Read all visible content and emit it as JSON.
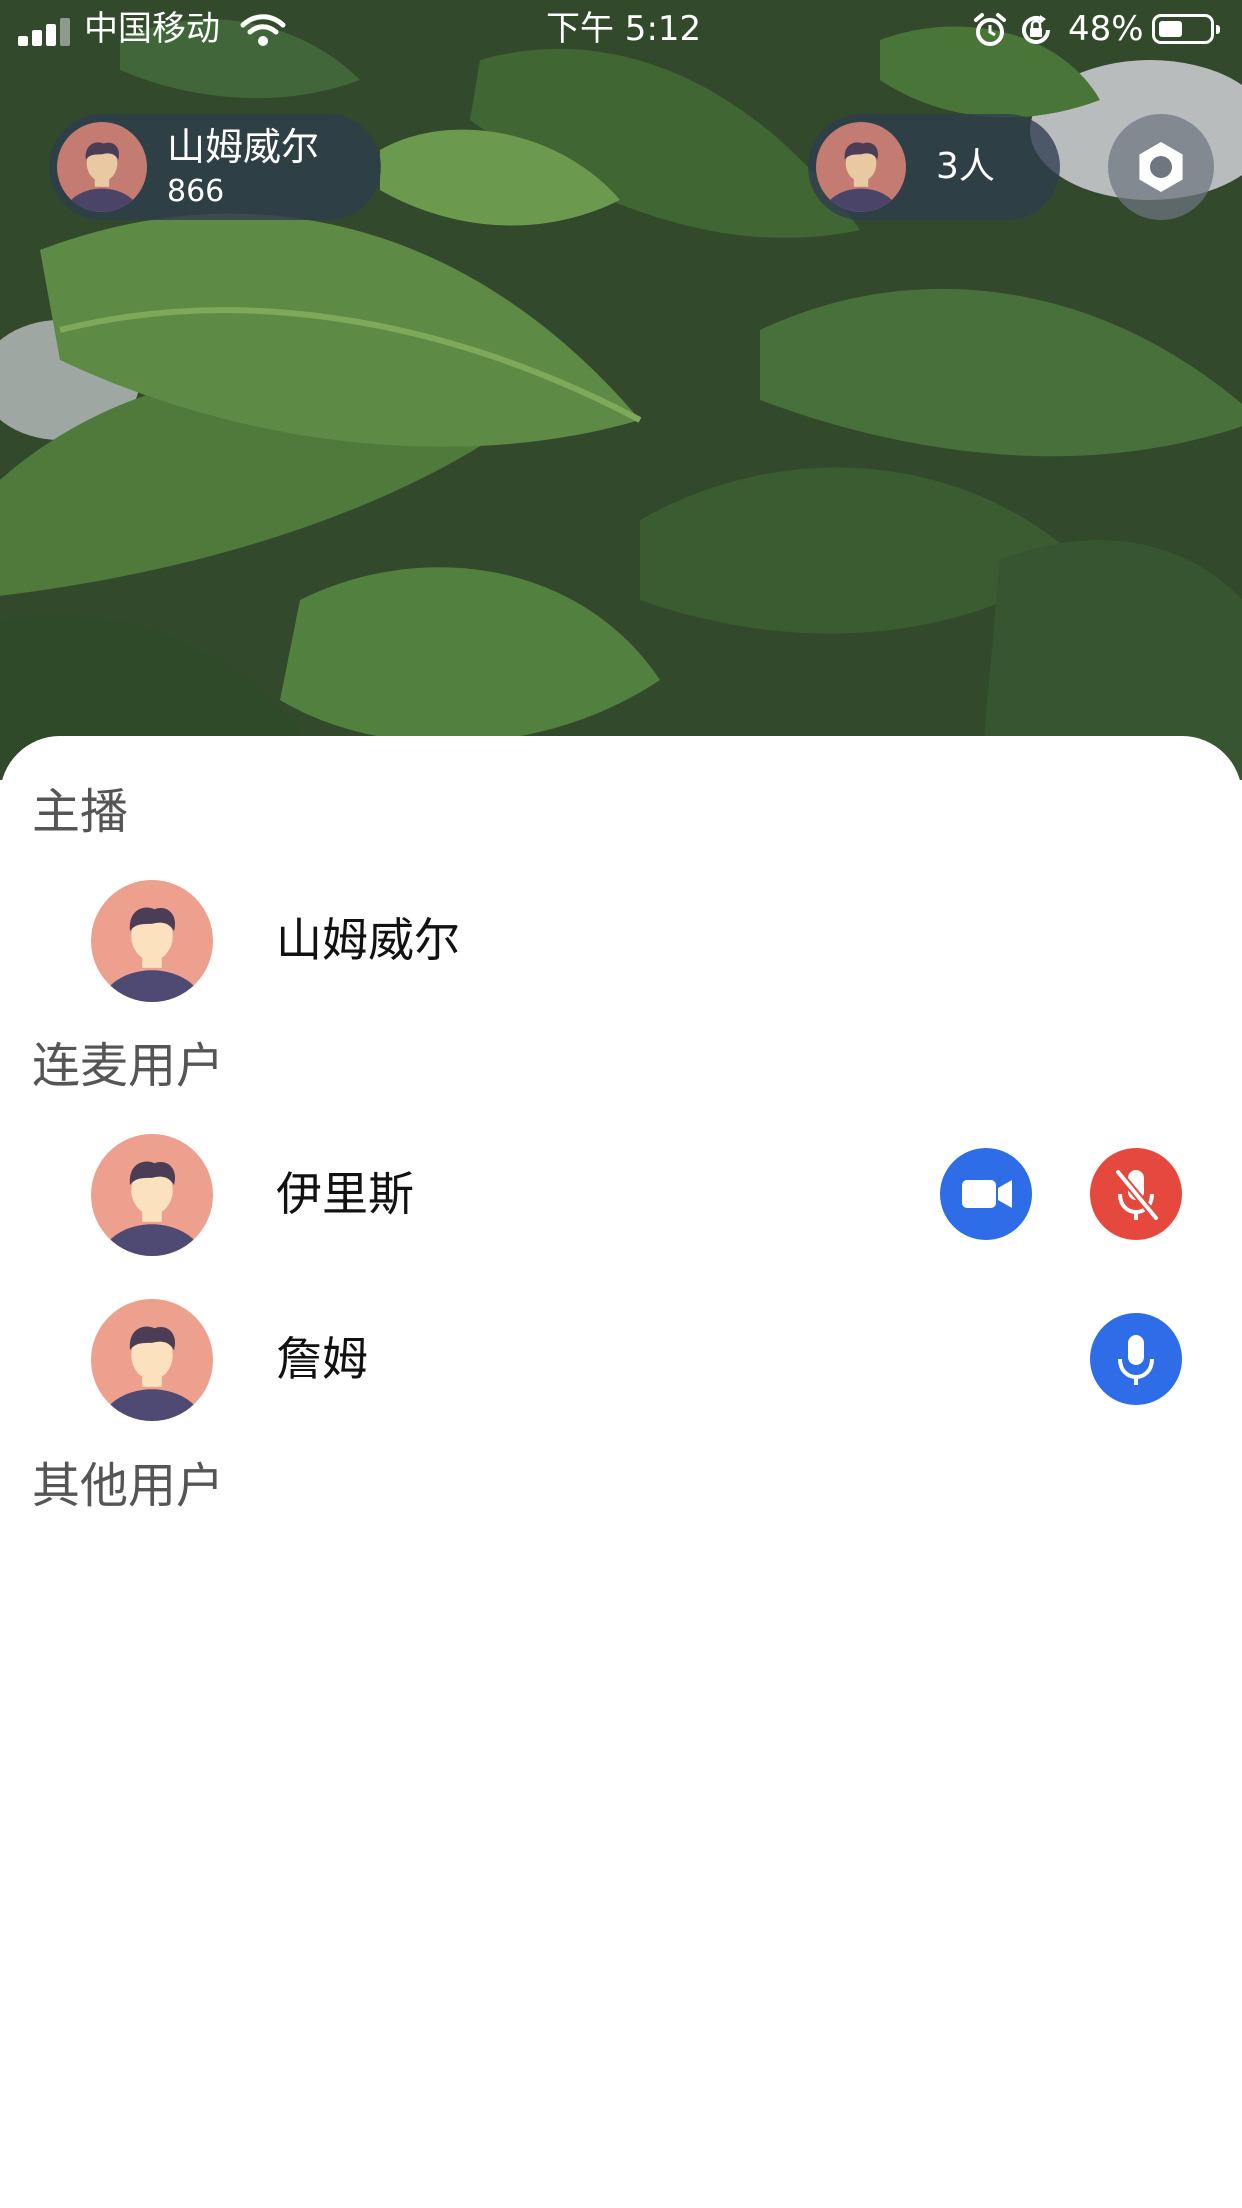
{
  "status_bar": {
    "carrier": "中国移动",
    "time": "下午 5:12",
    "battery": "48%",
    "battery_level": 0.48,
    "icons": [
      "signal-icon",
      "wifi-icon",
      "alarm-icon",
      "orientation-lock-icon",
      "battery-icon"
    ]
  },
  "host_pill": {
    "name": "山姆威尔",
    "count": "866",
    "icon": "avatar"
  },
  "viewers_pill": {
    "count": "3人",
    "icon": "avatar"
  },
  "settings": {
    "icon": "settings-gear-icon"
  },
  "colors": {
    "accent_blue": "#2f6de8",
    "mute_red": "#e5493e",
    "avatar_bg": "#eea08f",
    "avatar_shirt": "#4f4a73",
    "section_gray": "#555555"
  },
  "sheet": {
    "host_section": {
      "title": "主播",
      "users": [
        {
          "name": "山姆威尔"
        }
      ]
    },
    "mic_section": {
      "title": "连麦用户",
      "users": [
        {
          "name": "伊里斯",
          "buttons": [
            "camera-icon",
            "mic-muted-icon"
          ]
        },
        {
          "name": "詹姆",
          "buttons": [
            "mic-icon"
          ]
        }
      ]
    },
    "other_section": {
      "title": "其他用户",
      "users": []
    }
  }
}
